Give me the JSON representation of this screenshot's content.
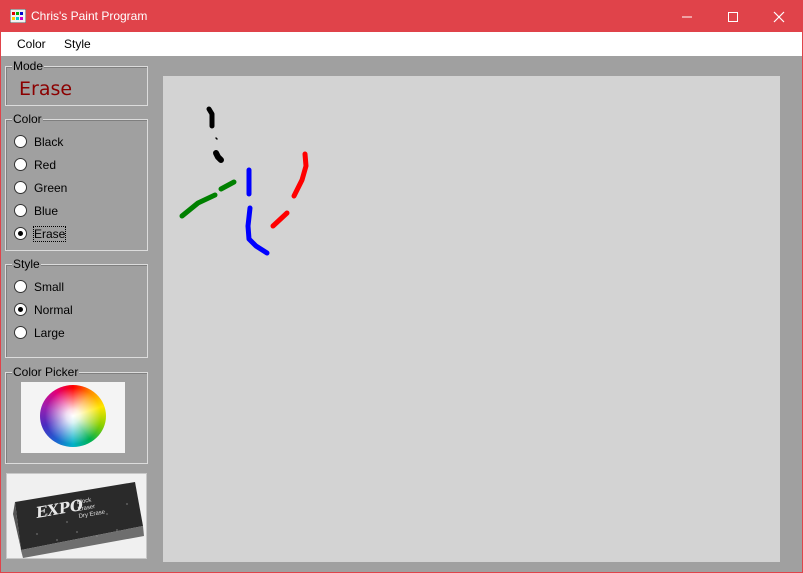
{
  "window": {
    "title": "Chris's Paint Program"
  },
  "menu": {
    "items": [
      "Color",
      "Style"
    ]
  },
  "mode": {
    "label": "Mode",
    "value": "Erase"
  },
  "color_group": {
    "label": "Color",
    "options": [
      "Black",
      "Red",
      "Green",
      "Blue",
      "Erase"
    ],
    "selected": "Erase"
  },
  "style_group": {
    "label": "Style",
    "options": [
      "Small",
      "Normal",
      "Large"
    ],
    "selected": "Normal"
  },
  "color_picker": {
    "label": "Color Picker"
  },
  "eraser_image": {
    "brand": "EXPO",
    "text_lines": [
      "Block",
      "Eraser",
      "Dry Erase"
    ]
  },
  "canvas": {
    "background": "#d3d3d3",
    "stroke_colors": {
      "black": "#000000",
      "red": "#ff0000",
      "green": "#008000",
      "blue": "#0000ff"
    }
  },
  "colors": {
    "titlebar": "#e0434a",
    "mode_text": "#8b0000",
    "panel": "#a0a0a0"
  }
}
